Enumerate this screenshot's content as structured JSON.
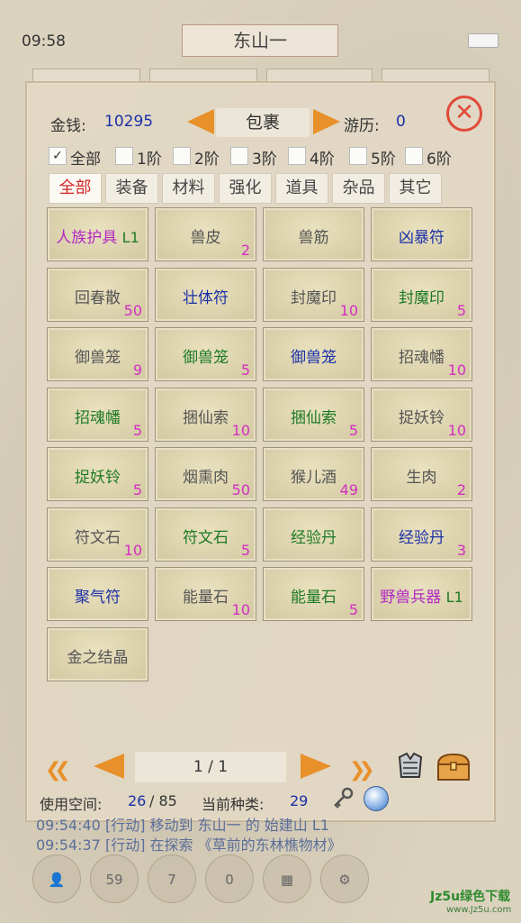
{
  "status": {
    "time": "09:58"
  },
  "location": {
    "title": "东山一"
  },
  "bag": {
    "gold_label": "金钱:",
    "gold_value": "10295",
    "title": "包裹",
    "exp_label": "游历:",
    "exp_value": "0",
    "close_icon": "close-x-icon",
    "filters": [
      {
        "label": "全部",
        "checked": true
      },
      {
        "label": "1阶",
        "checked": false
      },
      {
        "label": "2阶",
        "checked": false
      },
      {
        "label": "3阶",
        "checked": false
      },
      {
        "label": "4阶",
        "checked": false
      },
      {
        "label": "5阶",
        "checked": false
      },
      {
        "label": "6阶",
        "checked": false
      }
    ],
    "tabs": [
      {
        "label": "全部",
        "active": true
      },
      {
        "label": "装备",
        "active": false
      },
      {
        "label": "材料",
        "active": false
      },
      {
        "label": "强化",
        "active": false
      },
      {
        "label": "道具",
        "active": false
      },
      {
        "label": "杂品",
        "active": false
      },
      {
        "label": "其它",
        "active": false
      }
    ],
    "items": [
      {
        "name": "人族护具",
        "level": "L1",
        "count": "",
        "color": "purple"
      },
      {
        "name": "兽皮",
        "level": "",
        "count": "2",
        "color": "gray"
      },
      {
        "name": "兽筋",
        "level": "",
        "count": "",
        "color": "gray"
      },
      {
        "name": "凶暴符",
        "level": "",
        "count": "",
        "color": "blue"
      },
      {
        "name": "回春散",
        "level": "",
        "count": "50",
        "color": "gray"
      },
      {
        "name": "壮体符",
        "level": "",
        "count": "",
        "color": "blue"
      },
      {
        "name": "封魔印",
        "level": "",
        "count": "10",
        "color": "gray"
      },
      {
        "name": "封魔印",
        "level": "",
        "count": "5",
        "color": "green"
      },
      {
        "name": "御兽笼",
        "level": "",
        "count": "9",
        "color": "gray"
      },
      {
        "name": "御兽笼",
        "level": "",
        "count": "5",
        "color": "green"
      },
      {
        "name": "御兽笼",
        "level": "",
        "count": "",
        "color": "blue"
      },
      {
        "name": "招魂幡",
        "level": "",
        "count": "10",
        "color": "gray"
      },
      {
        "name": "招魂幡",
        "level": "",
        "count": "5",
        "color": "green"
      },
      {
        "name": "捆仙索",
        "level": "",
        "count": "10",
        "color": "gray"
      },
      {
        "name": "捆仙索",
        "level": "",
        "count": "5",
        "color": "green"
      },
      {
        "name": "捉妖铃",
        "level": "",
        "count": "10",
        "color": "gray"
      },
      {
        "name": "捉妖铃",
        "level": "",
        "count": "5",
        "color": "green"
      },
      {
        "name": "烟熏肉",
        "level": "",
        "count": "50",
        "color": "gray"
      },
      {
        "name": "猴儿酒",
        "level": "",
        "count": "49",
        "color": "gray"
      },
      {
        "name": "生肉",
        "level": "",
        "count": "2",
        "color": "gray"
      },
      {
        "name": "符文石",
        "level": "",
        "count": "10",
        "color": "gray"
      },
      {
        "name": "符文石",
        "level": "",
        "count": "5",
        "color": "green"
      },
      {
        "name": "经验丹",
        "level": "",
        "count": "",
        "color": "green"
      },
      {
        "name": "经验丹",
        "level": "",
        "count": "3",
        "color": "blue"
      },
      {
        "name": "聚气符",
        "level": "",
        "count": "",
        "color": "blue"
      },
      {
        "name": "能量石",
        "level": "",
        "count": "10",
        "color": "gray"
      },
      {
        "name": "能量石",
        "level": "",
        "count": "5",
        "color": "green"
      },
      {
        "name": "野兽兵器",
        "level": "L1",
        "count": "",
        "color": "purple"
      },
      {
        "name": "金之结晶",
        "level": "",
        "count": "",
        "color": "gray"
      }
    ],
    "page_indicator": "1 / 1",
    "space_label": "使用空间:",
    "space_used": "26",
    "space_total": "/ 85",
    "kind_label": "当前种类:",
    "kind_value": "29"
  },
  "log": {
    "line1": "09:54:40 [行动] 移动到 东山一 的 始建山 L1",
    "line2": "09:54:37 [行动] 在探索 《草前的东林樵物材》"
  },
  "bottombar": {
    "badge_1": "59",
    "badge_2": "7",
    "badge_3": "0"
  },
  "watermark": {
    "main": "Jz5u绿色下载",
    "sub": "www.Jz5u.com"
  },
  "colors": {
    "gray": "#555555",
    "green": "#1d7a24",
    "blue": "#1a2fa8",
    "purple": "#b228c4",
    "count": "#d42ec2",
    "accent": "#e8902a",
    "close": "#e04a3a"
  }
}
